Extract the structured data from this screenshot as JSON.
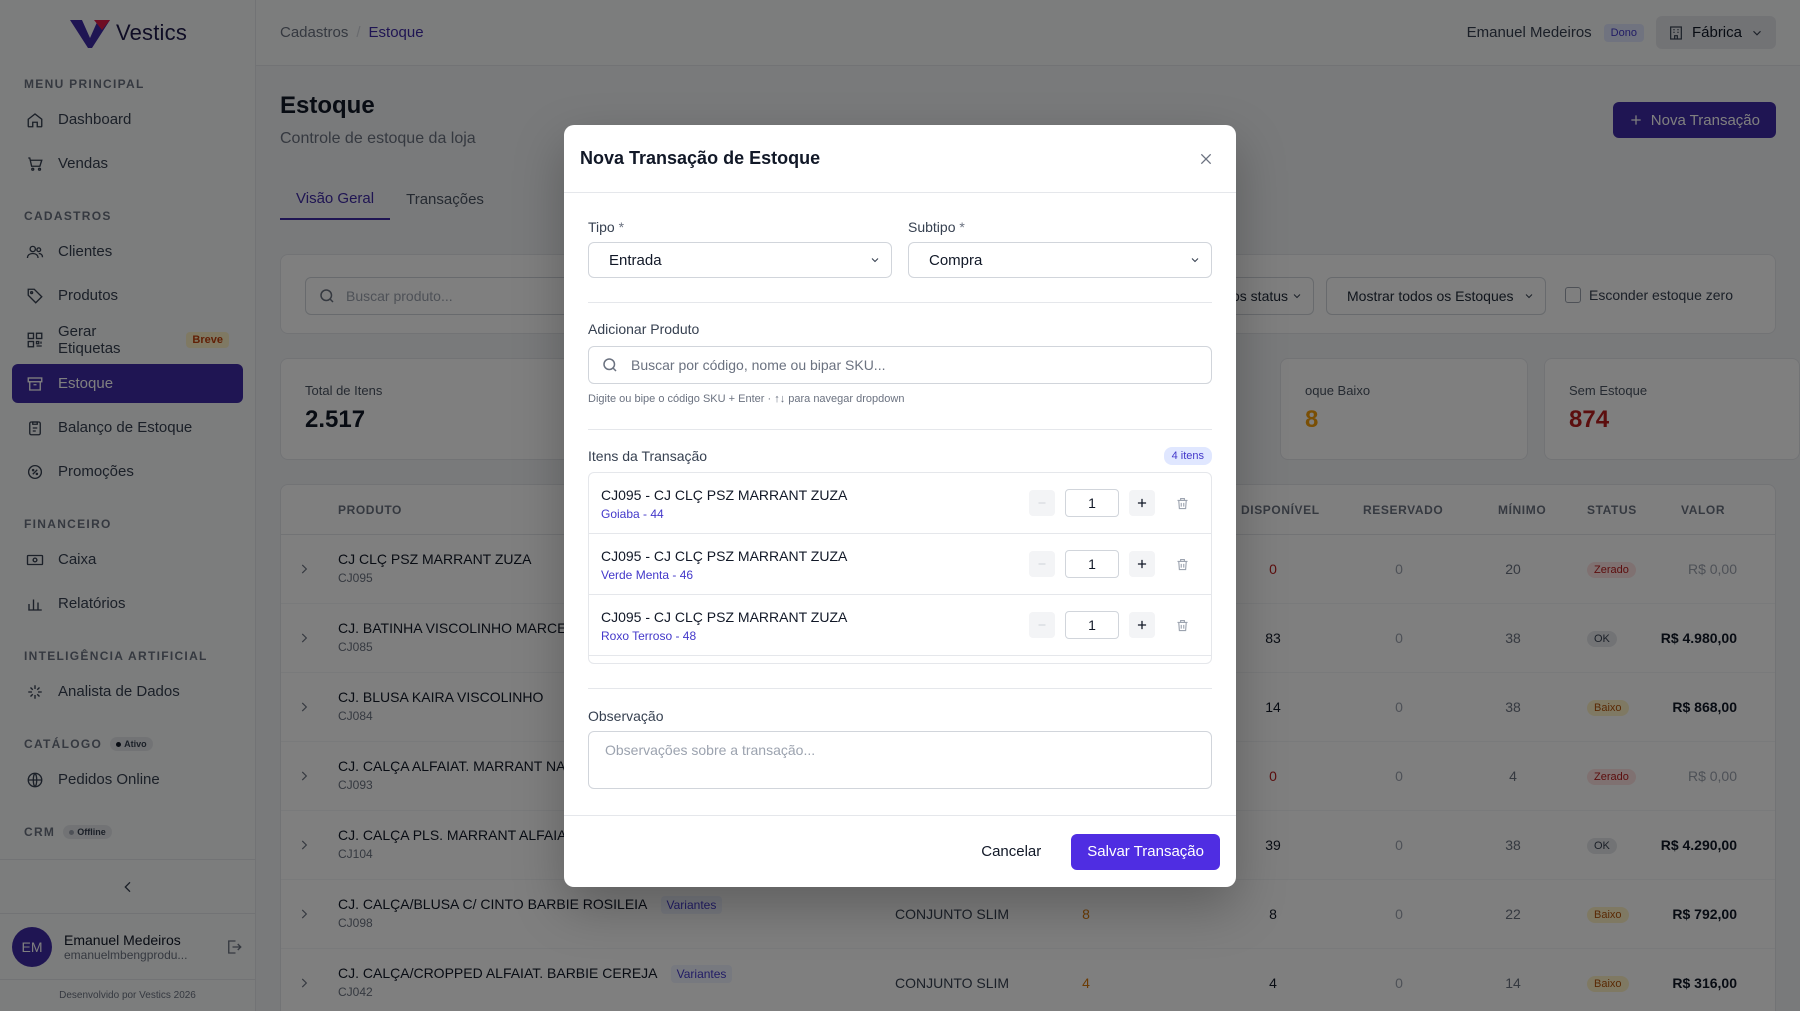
{
  "brand": {
    "name": "Vestics"
  },
  "sidebar": {
    "sections": [
      {
        "title": "MENU PRINCIPAL",
        "items": [
          "Dashboard",
          "Vendas"
        ]
      },
      {
        "title": "CADASTROS",
        "items": [
          "Clientes",
          "Produtos",
          "Gerar Etiquetas",
          "Estoque",
          "Balanço de Estoque",
          "Promoções"
        ]
      },
      {
        "title": "FINANCEIRO",
        "items": [
          "Caixa",
          "Relatórios"
        ]
      },
      {
        "title": "INTELIGÊNCIA ARTIFICIAL",
        "items": [
          "Analista de Dados"
        ]
      },
      {
        "title": "CATÁLOGO",
        "badge": "Ativo",
        "items": [
          "Pedidos Online"
        ]
      },
      {
        "title": "CRM",
        "badge": "Offline",
        "items": []
      }
    ],
    "breve_badge": "Breve",
    "active_item": "Estoque",
    "user": {
      "initials": "EM",
      "name": "Emanuel Medeiros",
      "email": "emanuelmbengprodu..."
    },
    "footer": "Desenvolvido por Vestics 2026"
  },
  "topbar": {
    "breadcrumb": [
      "Cadastros",
      "Estoque"
    ],
    "separator": "/",
    "user_name": "Emanuel Medeiros",
    "role_badge": "Dono",
    "store": "Fábrica"
  },
  "page": {
    "title": "Estoque",
    "subtitle": "Controle de estoque da loja",
    "new_button": "Nova Transação",
    "tabs": [
      "Visão Geral",
      "Transações"
    ],
    "search_placeholder": "Buscar produto...",
    "filter_status": "os status",
    "filter_stock": "Mostrar todos os Estoques",
    "hide_zero_label": "Esconder estoque zero"
  },
  "stats": [
    {
      "label": "Total de Itens",
      "value": "2.517",
      "color": "#111827"
    },
    {
      "label": "oque Baixo",
      "value": "8",
      "color": "#f59e0b"
    },
    {
      "label": "Sem Estoque",
      "value": "874",
      "color": "#b91c1c"
    }
  ],
  "table": {
    "headers": [
      "PRODUTO",
      "DISPONÍVEL",
      "RESERVADO",
      "MÍNIMO",
      "STATUS",
      "VALOR"
    ],
    "rows": [
      {
        "name": "CJ CLÇ PSZ MARRANT ZUZA",
        "sku": "CJ095",
        "variant": "",
        "category": "",
        "qty": "",
        "available": "0",
        "reserved": "0",
        "minimum": "20",
        "status": "Zerado",
        "value": "R$ 0,00"
      },
      {
        "name": "CJ. BATINHA VISCOLINHO MARCE",
        "sku": "CJ085",
        "variant": "",
        "category": "",
        "qty": "",
        "available": "83",
        "reserved": "0",
        "minimum": "38",
        "status": "OK",
        "value": "R$ 4.980,00"
      },
      {
        "name": "CJ. BLUSA KAIRA VISCOLINHO",
        "sku": "CJ084",
        "variant": "",
        "category": "",
        "qty": "",
        "available": "14",
        "reserved": "0",
        "minimum": "38",
        "status": "Baixo",
        "value": "R$ 868,00"
      },
      {
        "name": "CJ. CALÇA ALFAIAT. MARRANT NA",
        "sku": "CJ093",
        "variant": "",
        "category": "",
        "qty": "",
        "available": "0",
        "reserved": "0",
        "minimum": "4",
        "status": "Zerado",
        "value": "R$ 0,00"
      },
      {
        "name": "CJ. CALÇA PLS. MARRANT ALFAIA",
        "sku": "CJ104",
        "variant": "",
        "category": "",
        "qty": "",
        "available": "39",
        "reserved": "0",
        "minimum": "38",
        "status": "OK",
        "value": "R$ 4.290,00"
      },
      {
        "name": "CJ. CALÇA/BLUSA C/ CINTO BARBIE ROSILEIA",
        "sku": "CJ098",
        "variant": "Variantes",
        "category": "CONJUNTO SLIM",
        "qty": "8",
        "available": "8",
        "reserved": "0",
        "minimum": "22",
        "status": "Baixo",
        "value": "R$ 792,00"
      },
      {
        "name": "CJ. CALÇA/CROPPED ALFAIAT. BARBIE CEREJA",
        "sku": "CJ042",
        "variant": "Variantes",
        "category": "CONJUNTO SLIM",
        "qty": "4",
        "available": "4",
        "reserved": "0",
        "minimum": "14",
        "status": "Baixo",
        "value": "R$ 316,00"
      }
    ]
  },
  "modal": {
    "title": "Nova Transação de Estoque",
    "tipo_label": "Tipo",
    "subtipo_label": "Subtipo",
    "required_mark": "*",
    "tipo_value": "Entrada",
    "subtipo_value": "Compra",
    "add_product_label": "Adicionar Produto",
    "search_placeholder": "Buscar por código, nome ou bipar SKU...",
    "hint": "Digite ou bipe o código SKU + Enter · ↑↓ para navegar dropdown",
    "items_label": "Itens da Transação",
    "items_count": "4 itens",
    "items": [
      {
        "name": "CJ095 - CJ CLÇ PSZ MARRANT ZUZA",
        "variant": "Goiaba - 44",
        "qty": "1"
      },
      {
        "name": "CJ095 - CJ CLÇ PSZ MARRANT ZUZA",
        "variant": "Verde Menta - 46",
        "qty": "1"
      },
      {
        "name": "CJ095 - CJ CLÇ PSZ MARRANT ZUZA",
        "variant": "Roxo Terroso - 48",
        "qty": "1"
      }
    ],
    "obs_label": "Observação",
    "obs_placeholder": "Observações sobre a transação...",
    "cancel": "Cancelar",
    "save": "Salvar Transação"
  }
}
